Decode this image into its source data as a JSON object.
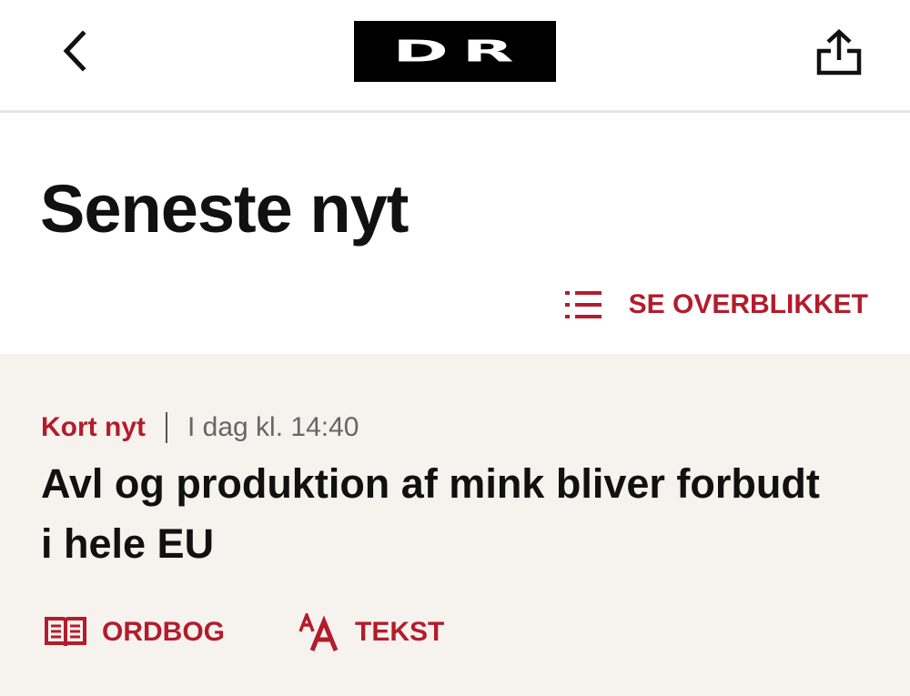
{
  "header": {
    "back_icon": "chevron-left-icon",
    "logo_text": "DR",
    "share_icon": "share-icon"
  },
  "page": {
    "title": "Seneste nyt",
    "overview_label": "SE OVERBLIKKET",
    "overview_icon": "list-icon"
  },
  "article": {
    "category": "Kort nyt",
    "timestamp": "I dag kl. 14:40",
    "headline": "Avl og produktion af mink bliver forbudt i hele EU"
  },
  "tools": {
    "dictionary_label": "ORDBOG",
    "dictionary_icon": "book-icon",
    "text_label": "TEKST",
    "text_icon": "text-size-icon"
  },
  "colors": {
    "accent": "#b31c2c",
    "card_background": "#f6f3ee",
    "logo_background": "#000000"
  }
}
